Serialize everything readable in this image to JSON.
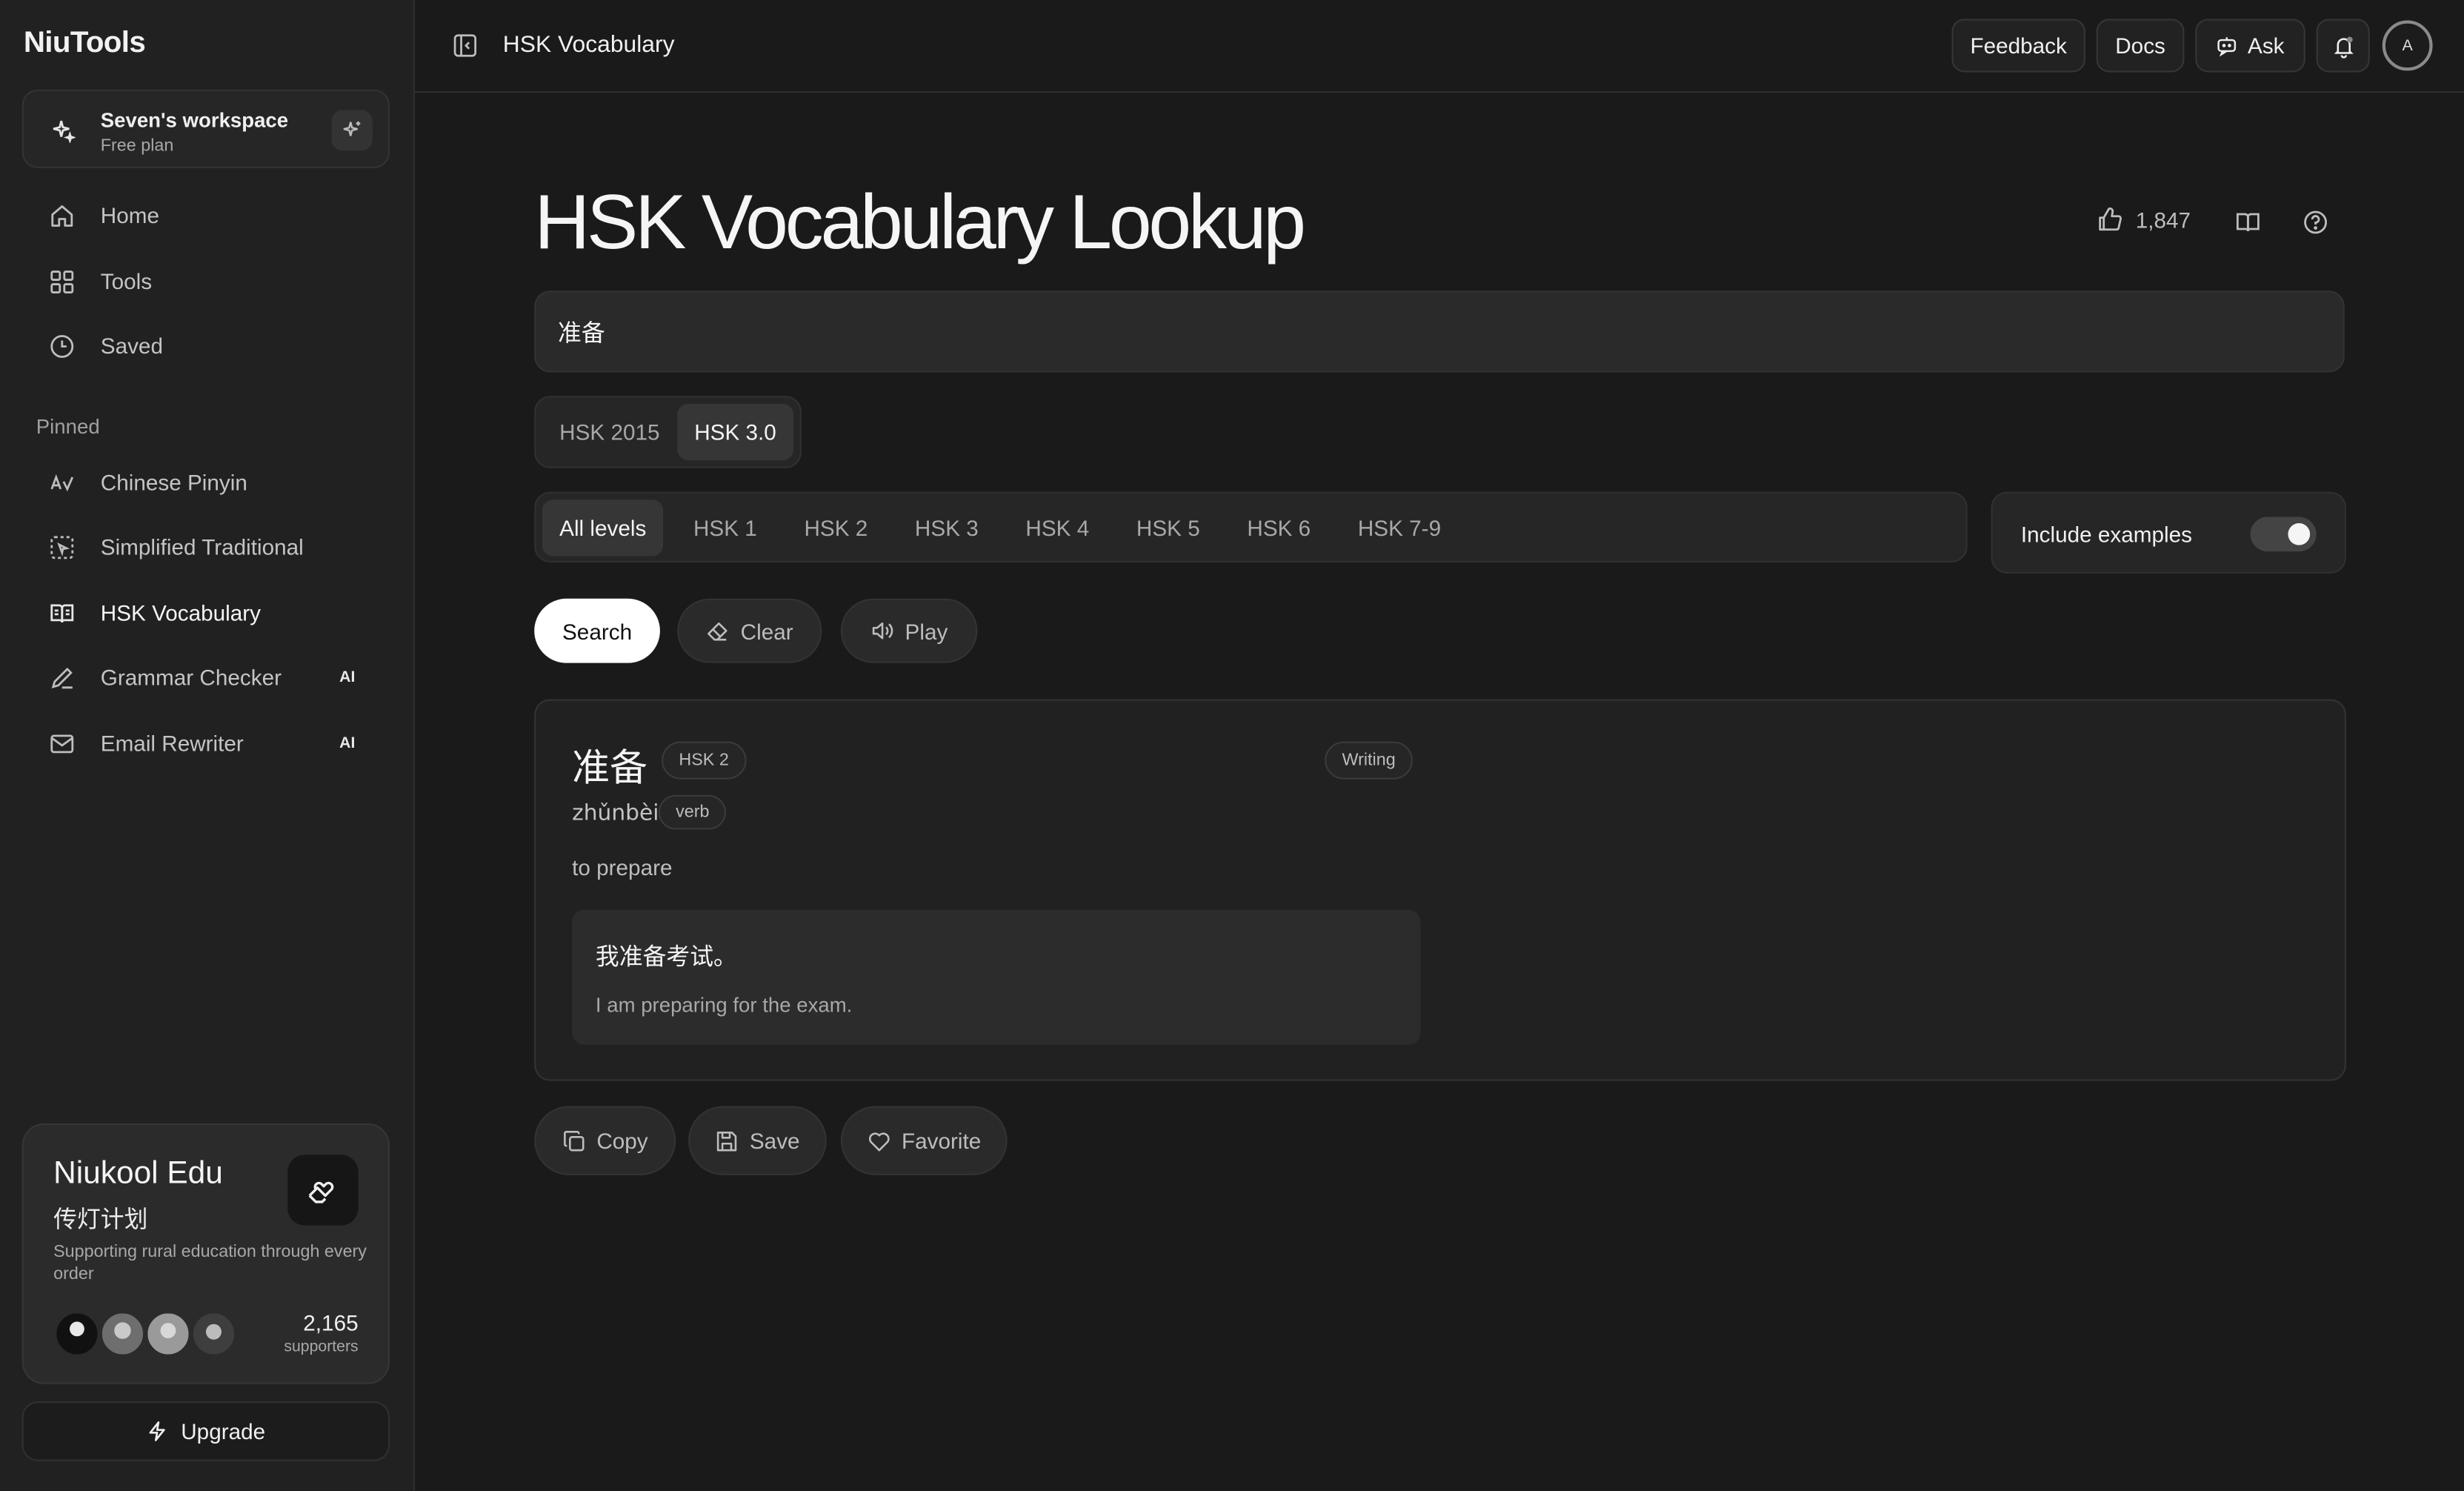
{
  "sidebar": {
    "brand": "NiuTools",
    "workspace": {
      "name": "Seven's workspace",
      "plan": "Free plan"
    },
    "nav": [
      {
        "label": "Home",
        "icon": "home-icon"
      },
      {
        "label": "Tools",
        "icon": "grid-icon"
      },
      {
        "label": "Saved",
        "icon": "clock-icon"
      }
    ],
    "pinned_label": "Pinned",
    "pinned": [
      {
        "label": "Chinese Pinyin",
        "icon": "pinyin-icon",
        "badge": ""
      },
      {
        "label": "Simplified Traditional",
        "icon": "convert-icon",
        "badge": ""
      },
      {
        "label": "HSK Vocabulary",
        "icon": "book-open-icon",
        "badge": "",
        "active": true
      },
      {
        "label": "Grammar Checker",
        "icon": "pen-icon",
        "badge": "AI"
      },
      {
        "label": "Email Rewriter",
        "icon": "mail-icon",
        "badge": "AI"
      }
    ],
    "promo": {
      "title": "Niukool Edu",
      "subtitle": "传灯计划",
      "description": "Supporting rural education through every order",
      "count": "2,165",
      "count_label": "supporters"
    },
    "upgrade_label": "Upgrade"
  },
  "topbar": {
    "breadcrumb": "HSK Vocabulary",
    "feedback": "Feedback",
    "docs": "Docs",
    "ask": "Ask",
    "avatar_initial": "A"
  },
  "page": {
    "title": "HSK Vocabulary Lookup",
    "likes": "1,847",
    "search": {
      "value": "准备",
      "placeholder": ""
    },
    "standards": [
      {
        "label": "HSK 2015",
        "selected": false
      },
      {
        "label": "HSK 3.0",
        "selected": true
      }
    ],
    "levels": [
      {
        "label": "All levels",
        "selected": true
      },
      {
        "label": "HSK 1"
      },
      {
        "label": "HSK 2"
      },
      {
        "label": "HSK 3"
      },
      {
        "label": "HSK 4"
      },
      {
        "label": "HSK 5"
      },
      {
        "label": "HSK 6"
      },
      {
        "label": "HSK 7-9"
      }
    ],
    "include_examples_label": "Include examples",
    "include_examples": true,
    "actions": {
      "search": "Search",
      "clear": "Clear",
      "play": "Play"
    },
    "result": {
      "word": "准备",
      "level": "HSK 2",
      "tag": "Writing",
      "pinyin": "zhǔnbèi",
      "pos": "verb",
      "meaning": "to prepare",
      "example_zh": "我准备考试。",
      "example_en": "I am preparing for the exam."
    },
    "footer_actions": {
      "copy": "Copy",
      "save": "Save",
      "favorite": "Favorite"
    }
  }
}
